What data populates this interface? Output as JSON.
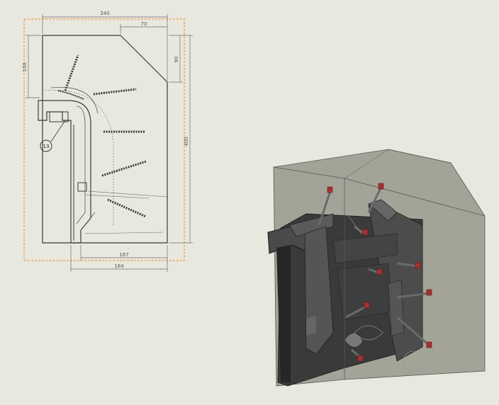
{
  "colors": {
    "background": "#e9e8df",
    "line": "#3a3a3a",
    "dimension": "#6b6b6b",
    "selection_box": "#e08a2e",
    "box_fill": "#8c8c80",
    "part_dark": "#2f2f2f",
    "pin_red": "#a83030"
  },
  "drawing": {
    "dimensions": {
      "overall_width": "240",
      "top_chamfer_width": "70",
      "left_height": "100",
      "right_height": "90",
      "total_height": "400",
      "bottom_inner_width": "167",
      "bottom_outer_width": "184"
    },
    "balloon_number": "13"
  }
}
